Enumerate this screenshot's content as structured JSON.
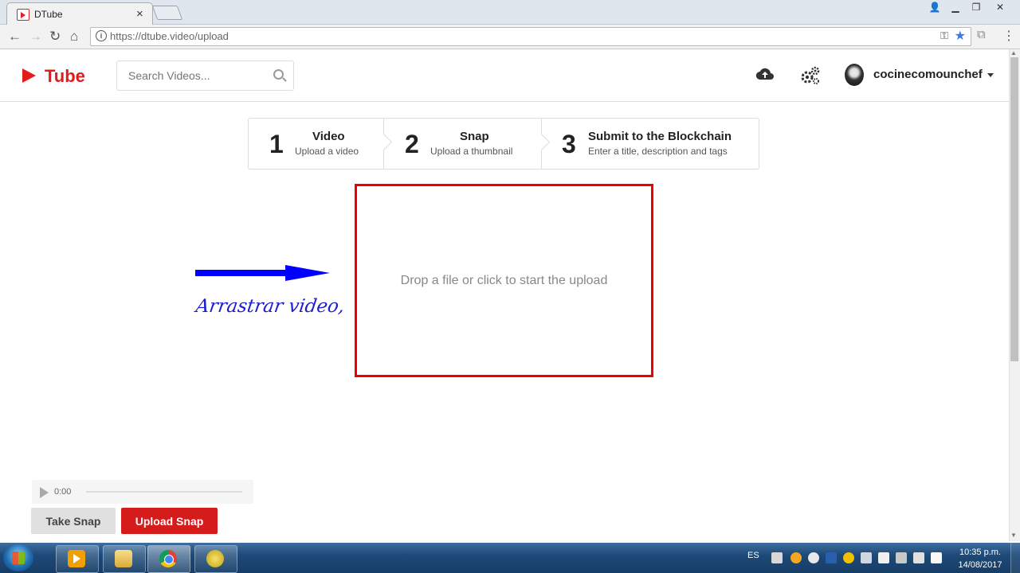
{
  "browser": {
    "tab_title": "DTube",
    "tab_close": "×",
    "url": "https://dtube.video/upload",
    "nav": {
      "back": "←",
      "forward": "→",
      "reload": "↻",
      "home": "⌂"
    }
  },
  "header": {
    "logo_text": "Tube",
    "search_placeholder": "Search Videos...",
    "username": "cocinecomounchef"
  },
  "steps": [
    {
      "number": "1",
      "title": "Video",
      "description": "Upload a video"
    },
    {
      "number": "2",
      "title": "Snap",
      "description": "Upload a thumbnail"
    },
    {
      "number": "3",
      "title": "Submit to the Blockchain",
      "description": "Enter a title, description and tags"
    }
  ],
  "dropzone": {
    "text": "Drop a file or click to start the upload",
    "border_color": "#ee0000"
  },
  "annotation": {
    "text": "Arrastrar video,",
    "color": "#0000ff"
  },
  "player": {
    "time": "0:00"
  },
  "buttons": {
    "take_snap": "Take Snap",
    "upload_snap": "Upload Snap"
  },
  "taskbar": {
    "language": "ES",
    "time": "10:35 p.m.",
    "date": "14/08/2017"
  },
  "colors": {
    "brand": "#e21b1b",
    "primary_button": "#d61b1b"
  }
}
